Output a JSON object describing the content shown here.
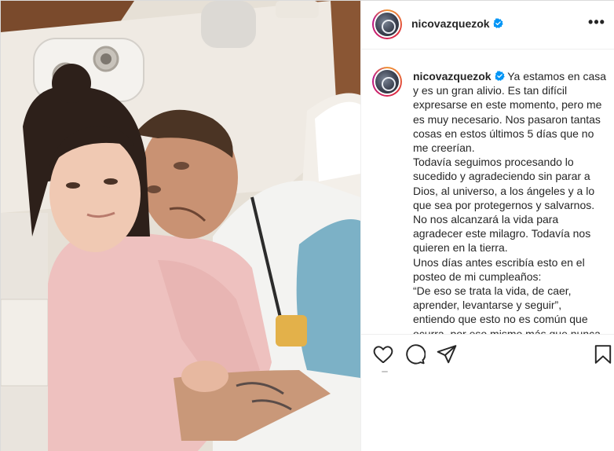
{
  "post": {
    "username": "nicovazquezok",
    "verified": true,
    "more_label": "•••",
    "caption_lines": [
      "Ya estamos en casa",
      "y es un gran alivio. Es tan difícil",
      "expresarse en este momento, pero me",
      "es muy necesario. Nos pasaron tantas",
      "cosas en estos últimos 5 días que no",
      "me creerían.",
      "Todavía seguimos procesando lo",
      "sucedido y agradeciendo sin parar a",
      "Dios, al universo, a los ángeles y a lo",
      "que sea por protegernos y salvarnos.",
      "No nos alcanzará la vida para",
      "agradecer este milagro. Todavía nos",
      "quieren en la tierra.",
      "Unos días antes escribía esto en el",
      "posteo de mi cumpleaños:",
      "“De eso se trata la vida, de caer,",
      "aprender, levantarse y seguir”,",
      "entiendo que esto no es común que",
      "ocurra, por eso mismo más que nunca"
    ]
  },
  "icons": {
    "verified": "verified-badge-icon",
    "like": "heart-icon",
    "comment": "comment-icon",
    "share": "paper-plane-icon",
    "save": "bookmark-icon"
  },
  "colors": {
    "text": "#262626",
    "verified_blue": "#0095f6",
    "border": "#efefef"
  }
}
